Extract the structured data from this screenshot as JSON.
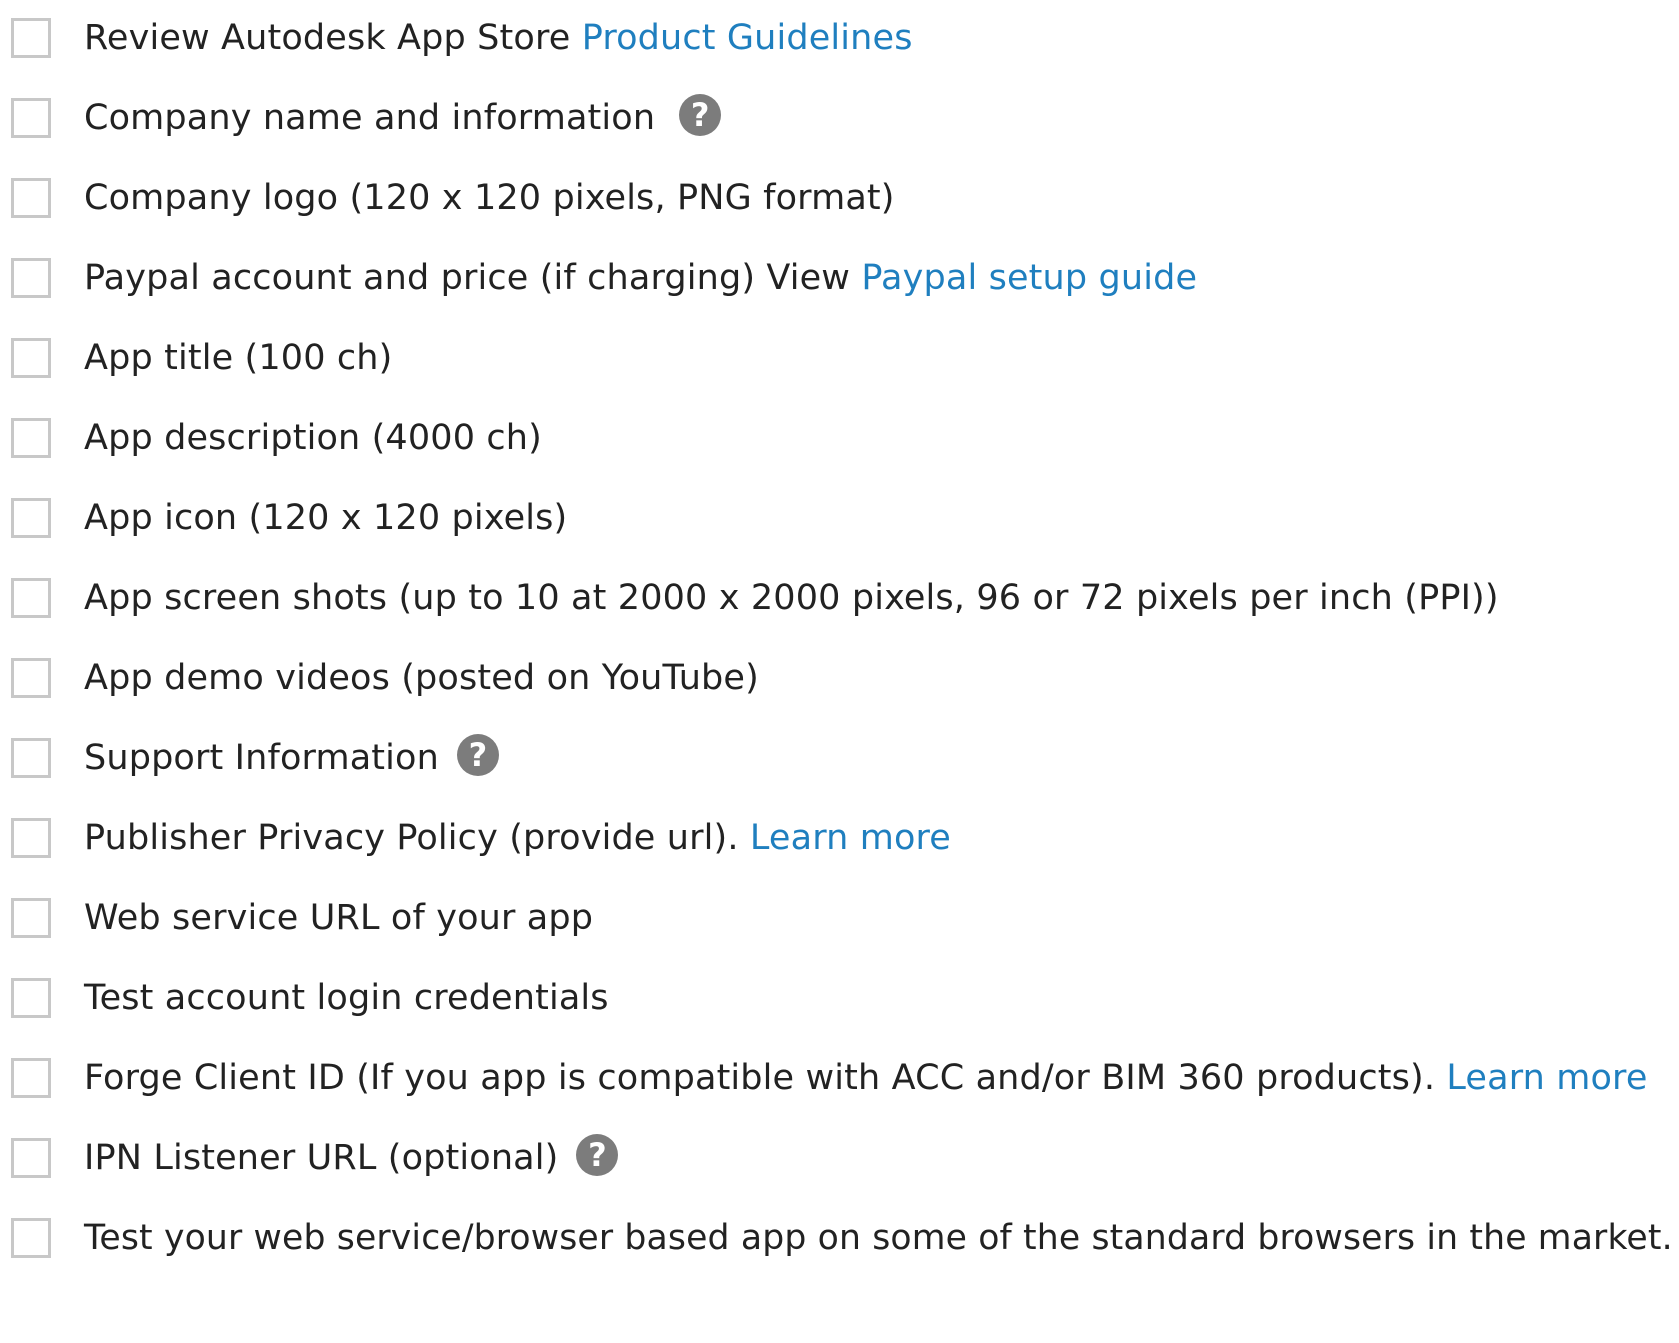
{
  "checklist": {
    "items": [
      {
        "before": "Review Autodesk App Store ",
        "link": "Product Guidelines",
        "after": ""
      },
      {
        "before": "Company name and information",
        "link": "",
        "after": "",
        "help_icon": "question-circle-icon",
        "help": "?"
      },
      {
        "before": "Company logo (120 x 120 pixels, PNG format)",
        "link": "",
        "after": ""
      },
      {
        "before": "Paypal account and price (if charging) View ",
        "link": "Paypal setup guide",
        "after": ""
      },
      {
        "before": "App title (100 ch)",
        "link": "",
        "after": ""
      },
      {
        "before": "App description (4000 ch)",
        "link": "",
        "after": ""
      },
      {
        "before": "App icon (120 x 120 pixels)",
        "link": "",
        "after": ""
      },
      {
        "before": "App screen shots (up to 10 at 2000 x 2000 pixels, 96 or 72 pixels per inch (PPI))",
        "link": "",
        "after": ""
      },
      {
        "before": "App demo videos (posted on YouTube)",
        "link": "",
        "after": ""
      },
      {
        "before": "Support Information",
        "link": "",
        "after": "",
        "help_icon": "question-circle-icon",
        "help": "?"
      },
      {
        "before": "Publisher Privacy Policy (provide url). ",
        "link": "Learn more",
        "after": ""
      },
      {
        "before": "Web service URL of your app",
        "link": "",
        "after": ""
      },
      {
        "before": "Test account login credentials",
        "link": "",
        "after": ""
      },
      {
        "before": "Forge Client ID (If you app is compatible with ACC and/or BIM 360 products). ",
        "link": "Learn more",
        "after": ""
      },
      {
        "before": "IPN Listener URL (optional)",
        "link": "",
        "after": "",
        "help_icon": "question-circle-icon",
        "help": "?"
      },
      {
        "before": "Test your web service/browser based app on some of the standard browsers in the market.",
        "link": "",
        "after": ""
      }
    ]
  },
  "colors": {
    "text": "#222222",
    "link": "#1f7fbf",
    "checkbox_border": "#c8c8c8",
    "help_icon_bg": "#7c7c7c"
  }
}
